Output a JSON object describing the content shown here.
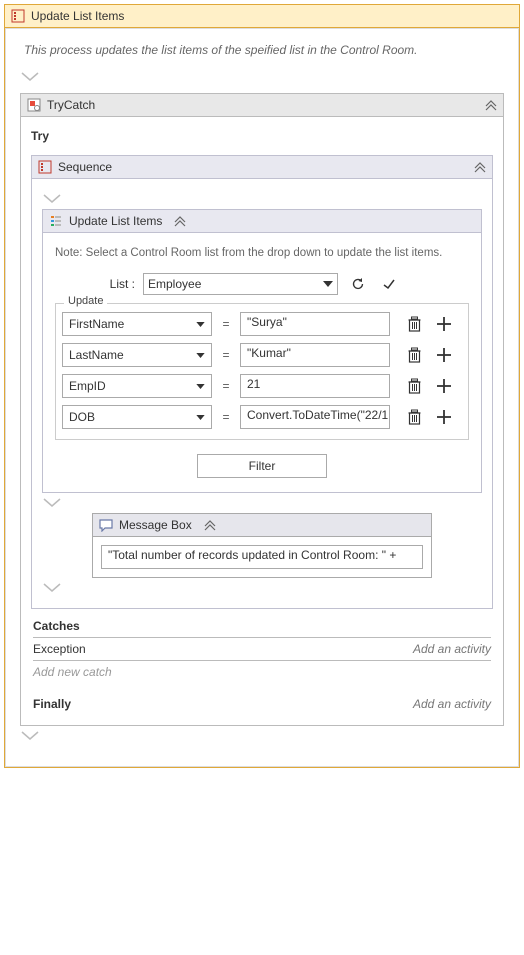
{
  "outer": {
    "title": "Update List Items",
    "description": "This process updates the list items of the speified list in the Control Room."
  },
  "trycatch": {
    "title": "TryCatch",
    "try_label": "Try",
    "catches_label": "Catches",
    "exception_label": "Exception",
    "add_activity": "Add an activity",
    "add_new_catch": "Add new catch",
    "finally_label": "Finally"
  },
  "sequence": {
    "title": "Sequence"
  },
  "updatelist": {
    "title": "Update List Items",
    "note": "Note: Select a Control Room list from the drop down to update the list items.",
    "list_label": "List :",
    "list_value": "Employee",
    "legend": "Update",
    "filter_label": "Filter",
    "rows": [
      {
        "field": "FirstName",
        "value": "\"Surya\""
      },
      {
        "field": "LastName",
        "value": "\"Kumar\""
      },
      {
        "field": "EmpID",
        "value": "21"
      },
      {
        "field": "DOB",
        "value": "Convert.ToDateTime(\"22/1"
      }
    ]
  },
  "msgbox": {
    "title": "Message Box",
    "text": "\"Total number of records updated in Control Room: \" +"
  }
}
